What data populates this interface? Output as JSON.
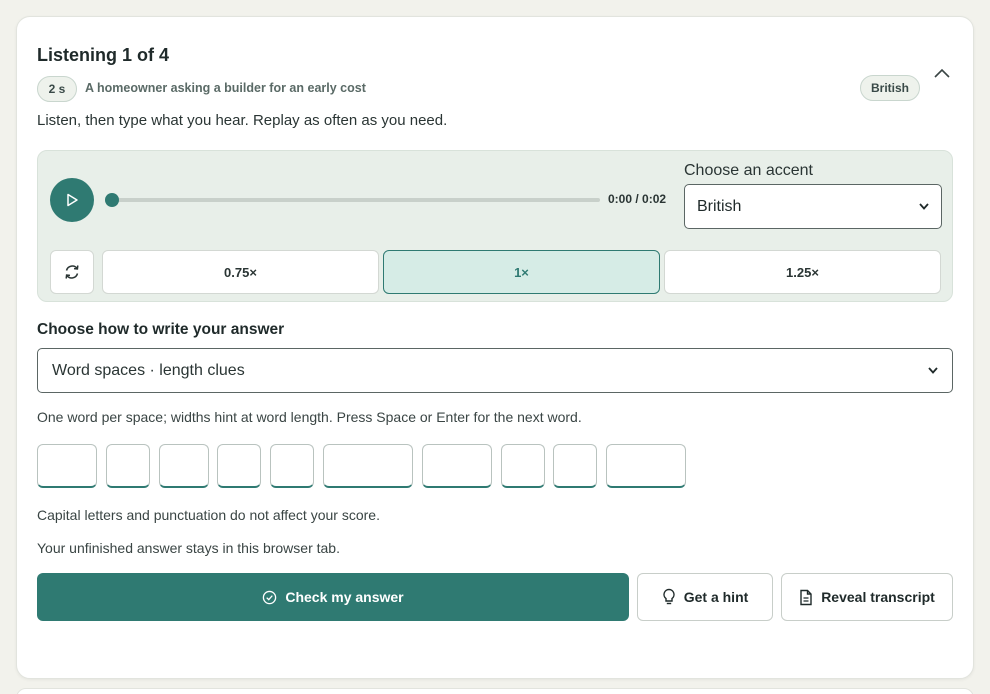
{
  "header": {
    "title": "Listening 1 of 4",
    "duration_badge": "2 s",
    "scenario": "A homeowner asking a builder for an early cost",
    "accent_badge": "British",
    "collapse_icon": "chevron-up-icon"
  },
  "instructions": "Listen, then type what you hear. Replay as often as you need.",
  "player": {
    "play_icon": "play-icon",
    "progress": 0,
    "time": "0:00 / 0:02",
    "accent_label": "Choose an accent",
    "accent_value": "British",
    "replay_icon": "replay-icon",
    "speeds": [
      "0.75×",
      "1×",
      "1.25×"
    ],
    "active_speed": "1×"
  },
  "answer": {
    "mode_label": "Choose how to write your answer",
    "mode_value": "Word spaces · length clues",
    "mode_hint": "One word per space; widths hint at word length. Press Space or Enter for the next word.",
    "note_scoring": "Capital letters and punctuation do not affect your score.",
    "note_saving": "Your unfinished answer stays in this browser tab."
  },
  "actions": {
    "check_label": "Check my answer",
    "hint_label": "Get a hint",
    "transcript_label": "Reveal transcript"
  },
  "colors": {
    "accent": "#2f7a72",
    "player_bg": "#e8efe9",
    "active_speed_bg": "#d6ece6",
    "page_bg": "#f2f2ec"
  }
}
